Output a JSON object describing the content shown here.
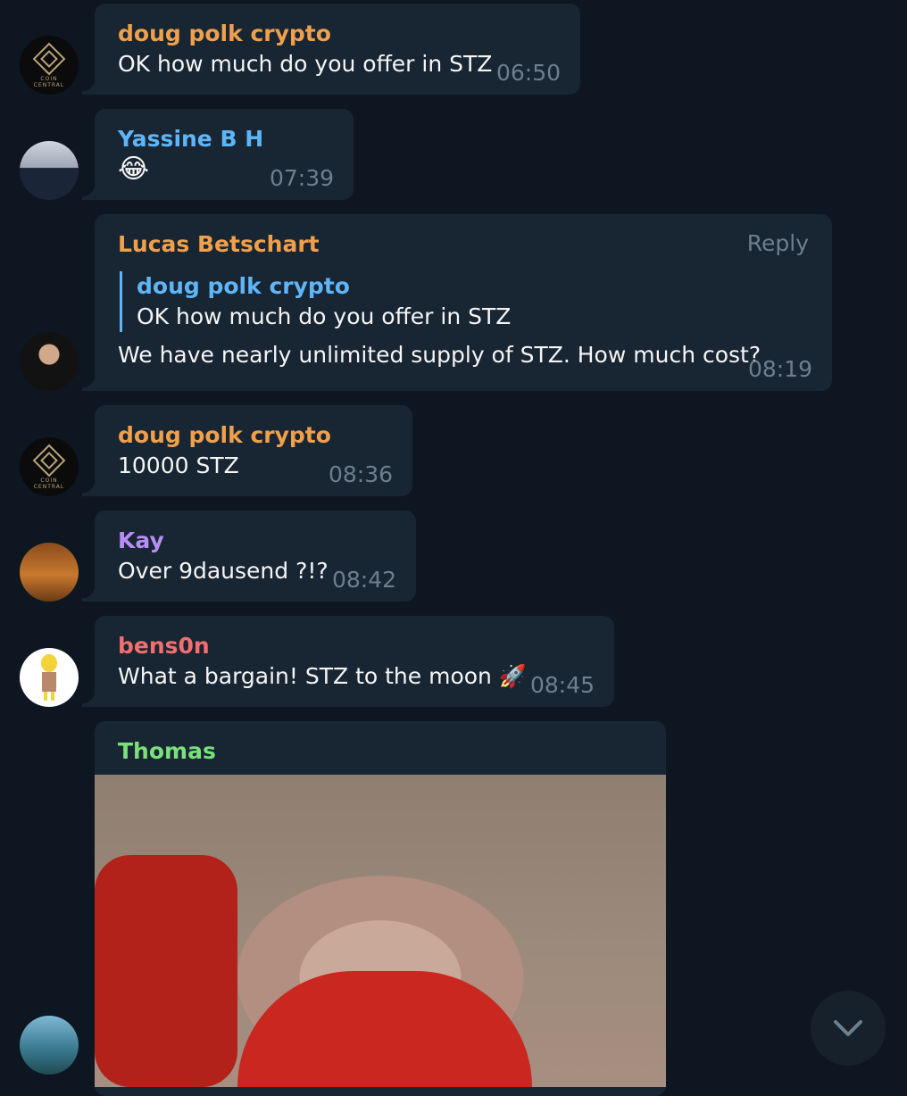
{
  "colors": {
    "background": "#0e1621",
    "bubble": "#182533",
    "time": "#6d7f8f",
    "name_orange": "#f0a04b",
    "name_blue": "#5eb5f7",
    "name_purple": "#b88df5",
    "name_red": "#f36e6e",
    "name_green": "#7be07b"
  },
  "avatar_coin": {
    "line1": "COIN",
    "line2": "CENTRAL"
  },
  "messages": [
    {
      "sender": "doug polk crypto",
      "text": "OK how much do you offer in STZ",
      "time": "06:50"
    },
    {
      "sender": "Yassine B H",
      "text": "😂",
      "time": "07:39"
    },
    {
      "sender": "Lucas Betschart",
      "reply_label": "Reply",
      "quote_sender": "doug polk crypto",
      "quote_text": "OK how much do you offer in STZ",
      "text": "We have nearly unlimited supply of STZ. How much cost?",
      "time": "08:19"
    },
    {
      "sender": "doug polk crypto",
      "text": "10000 STZ",
      "time": "08:36"
    },
    {
      "sender": "Kay",
      "text": "Over 9dausend ?!?",
      "time": "08:42"
    },
    {
      "sender": "bens0n",
      "text": "What a bargain! STZ to the moon 🚀",
      "time": "08:45"
    },
    {
      "sender": "Thomas",
      "media": "gif"
    }
  ],
  "scroll_button_icon": "chevron-down-icon"
}
